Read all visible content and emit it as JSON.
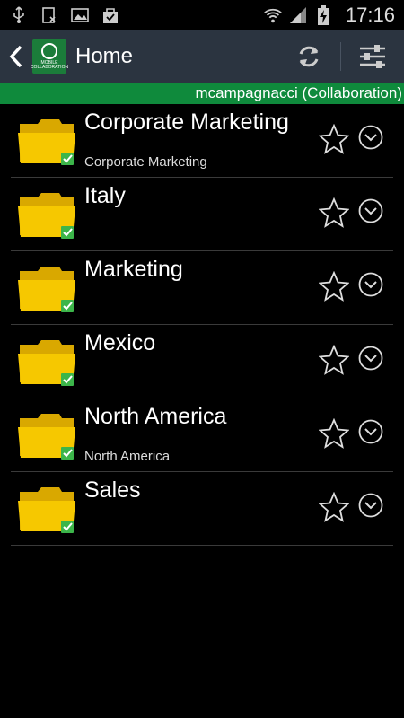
{
  "statusbar": {
    "time": "17:16"
  },
  "header": {
    "title": "Home"
  },
  "user": {
    "label": "mcampagnacci (Collaboration)"
  },
  "colors": {
    "actionbar": "#2b3440",
    "userbar": "#0f8a3c",
    "folder": "#f6c800"
  },
  "folders": [
    {
      "name": "Corporate Marketing",
      "subtitle": "Corporate Marketing"
    },
    {
      "name": "Italy",
      "subtitle": ""
    },
    {
      "name": "Marketing",
      "subtitle": ""
    },
    {
      "name": "Mexico",
      "subtitle": ""
    },
    {
      "name": "North America",
      "subtitle": "North America"
    },
    {
      "name": "Sales",
      "subtitle": ""
    }
  ]
}
